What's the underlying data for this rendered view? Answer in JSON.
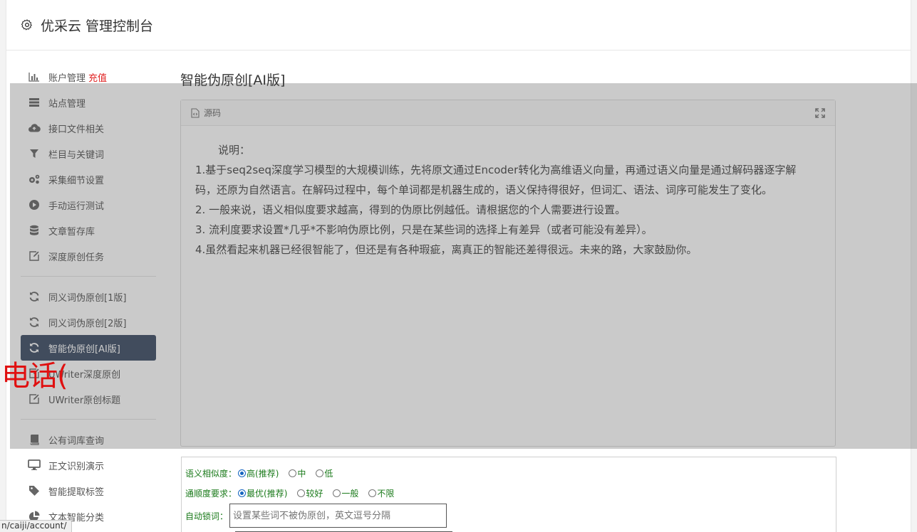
{
  "header": {
    "title": "优采云 管理控制台",
    "icon": "gear-icon"
  },
  "sidebar": {
    "group1": [
      {
        "label": "账户管理",
        "extra": "充值",
        "icon": "bar-chart-icon"
      },
      {
        "label": "站点管理",
        "icon": "server-icon"
      },
      {
        "label": "接口文件相关",
        "icon": "cloud-upload-icon"
      },
      {
        "label": "栏目与关键词",
        "icon": "filter-icon"
      },
      {
        "label": "采集细节设置",
        "icon": "cogs-icon"
      },
      {
        "label": "手动运行测试",
        "icon": "play-circle-icon"
      },
      {
        "label": "文章暂存库",
        "icon": "database-icon"
      },
      {
        "label": "深度原创任务",
        "icon": "edit-icon"
      }
    ],
    "group2": [
      {
        "label": "同义词伪原创[1版]",
        "icon": "refresh-icon"
      },
      {
        "label": "同义词伪原创[2版]",
        "icon": "refresh-icon"
      },
      {
        "label": "智能伪原创[AI版]",
        "icon": "refresh-icon",
        "active": true
      },
      {
        "label": "UWriter深度原创",
        "icon": "edit-icon"
      },
      {
        "label": "UWriter原创标题",
        "icon": "edit-icon"
      }
    ],
    "group3": [
      {
        "label": "公有词库查询",
        "icon": "book-icon"
      },
      {
        "label": "正文识别演示",
        "icon": "monitor-icon"
      },
      {
        "label": "智能提取标签",
        "icon": "tag-icon"
      },
      {
        "label": "文本智能分类",
        "icon": "pie-chart-icon"
      }
    ]
  },
  "main": {
    "title": "智能伪原创[AI版]",
    "panel_title": "源码",
    "desc_intro": "说明：",
    "desc_lines": [
      "1.基于seq2seq深度学习模型的大规模训练，先将原文通过Encoder转化为高维语义向量，再通过语义向量是通过解码器逐字解码，还原为自然语言。在解码过程中，每个单词都是机器生成的，语义保持得很好，但词汇、语法、词序可能发生了变化。",
      "2. 一般来说，语义相似度要求越高，得到的伪原比例越低。请根据您的个人需要进行设置。",
      "3. 流利度要求设置*几乎*不影响伪原比例，只是在某些词的选择上有差异（或者可能没有差异）。",
      "4.虽然看起来机器已经很智能了，但还是有各种瑕疵，离真正的智能还差得很远。未来的路，大家鼓励你。"
    ]
  },
  "form": {
    "similarity_label": "语义相似度：",
    "similarity_options": [
      "高(推荐)",
      "中",
      "低"
    ],
    "fluency_label": "通顺度要求：",
    "fluency_options": [
      "最优(推荐)",
      "较好",
      "一般",
      "不限"
    ],
    "lock_label": "自动锁词：",
    "lock_placeholder": "设置某些词不被伪原创，英文逗号分隔"
  },
  "watermark": "电话(",
  "status_url": "n/caiji/account/"
}
